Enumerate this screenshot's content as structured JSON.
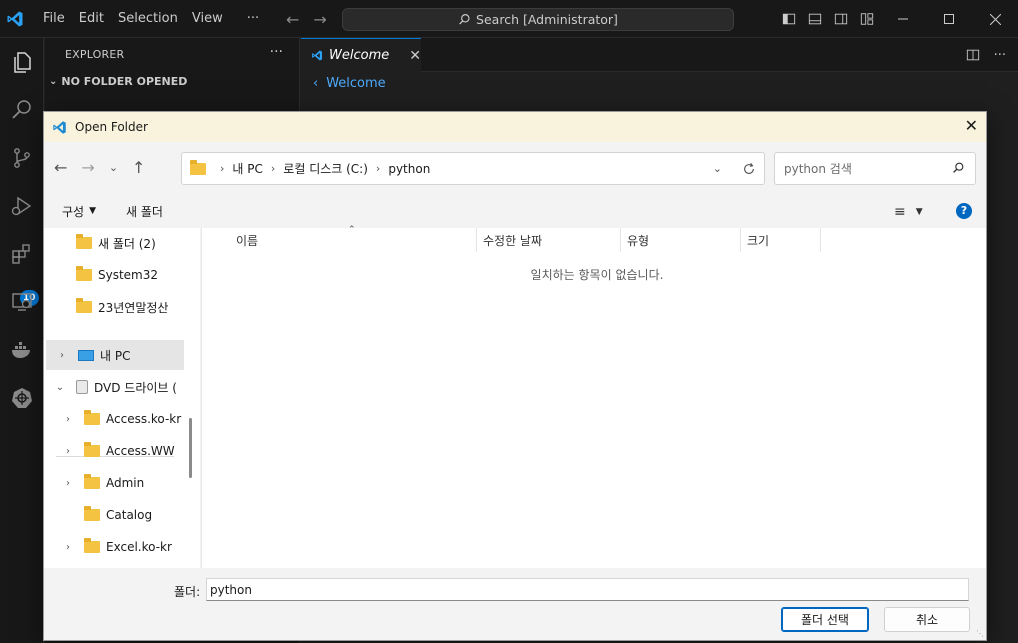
{
  "titlebar": {
    "menu": [
      "File",
      "Edit",
      "Selection",
      "View",
      "···"
    ],
    "search": "Search [Administrator]"
  },
  "activity": {
    "extensions_badge": "10"
  },
  "sidebar": {
    "title": "EXPLORER",
    "more": "···",
    "section": "NO FOLDER OPENED"
  },
  "editor": {
    "tab_label": "Welcome",
    "breadcrumb": "Welcome"
  },
  "dialog": {
    "title": "Open Folder",
    "path": [
      "내 PC",
      "로컬 디스크 (C:)",
      "python"
    ],
    "search_placeholder": "python 검색",
    "organize_label": "구성",
    "new_folder_label": "새 폴더",
    "nav_items": [
      {
        "label": "새 폴더 (2)",
        "chevron": "",
        "indent": 0
      },
      {
        "label": "System32",
        "chevron": "",
        "indent": 0
      },
      {
        "label": "23년연말정산",
        "chevron": "",
        "indent": 0
      },
      {
        "label": "내 PC",
        "chevron": ">",
        "indent": 0,
        "selected": true
      },
      {
        "label": "DVD 드라이브 (",
        "chevron": "v",
        "indent": 0
      },
      {
        "label": "Access.ko-kr",
        "chevron": ">",
        "indent": 1
      },
      {
        "label": "Access.WW",
        "chevron": ">",
        "indent": 1
      },
      {
        "label": "Admin",
        "chevron": ">",
        "indent": 1
      },
      {
        "label": "Catalog",
        "chevron": "",
        "indent": 1
      },
      {
        "label": "Excel.ko-kr",
        "chevron": ">",
        "indent": 1
      }
    ],
    "columns": [
      "이름",
      "수정한 날짜",
      "유형",
      "크기"
    ],
    "empty_message": "일치하는 항목이 없습니다.",
    "folder_label": "폴더:",
    "folder_value": "python",
    "select_button": "폴더 선택",
    "cancel_button": "취소"
  }
}
